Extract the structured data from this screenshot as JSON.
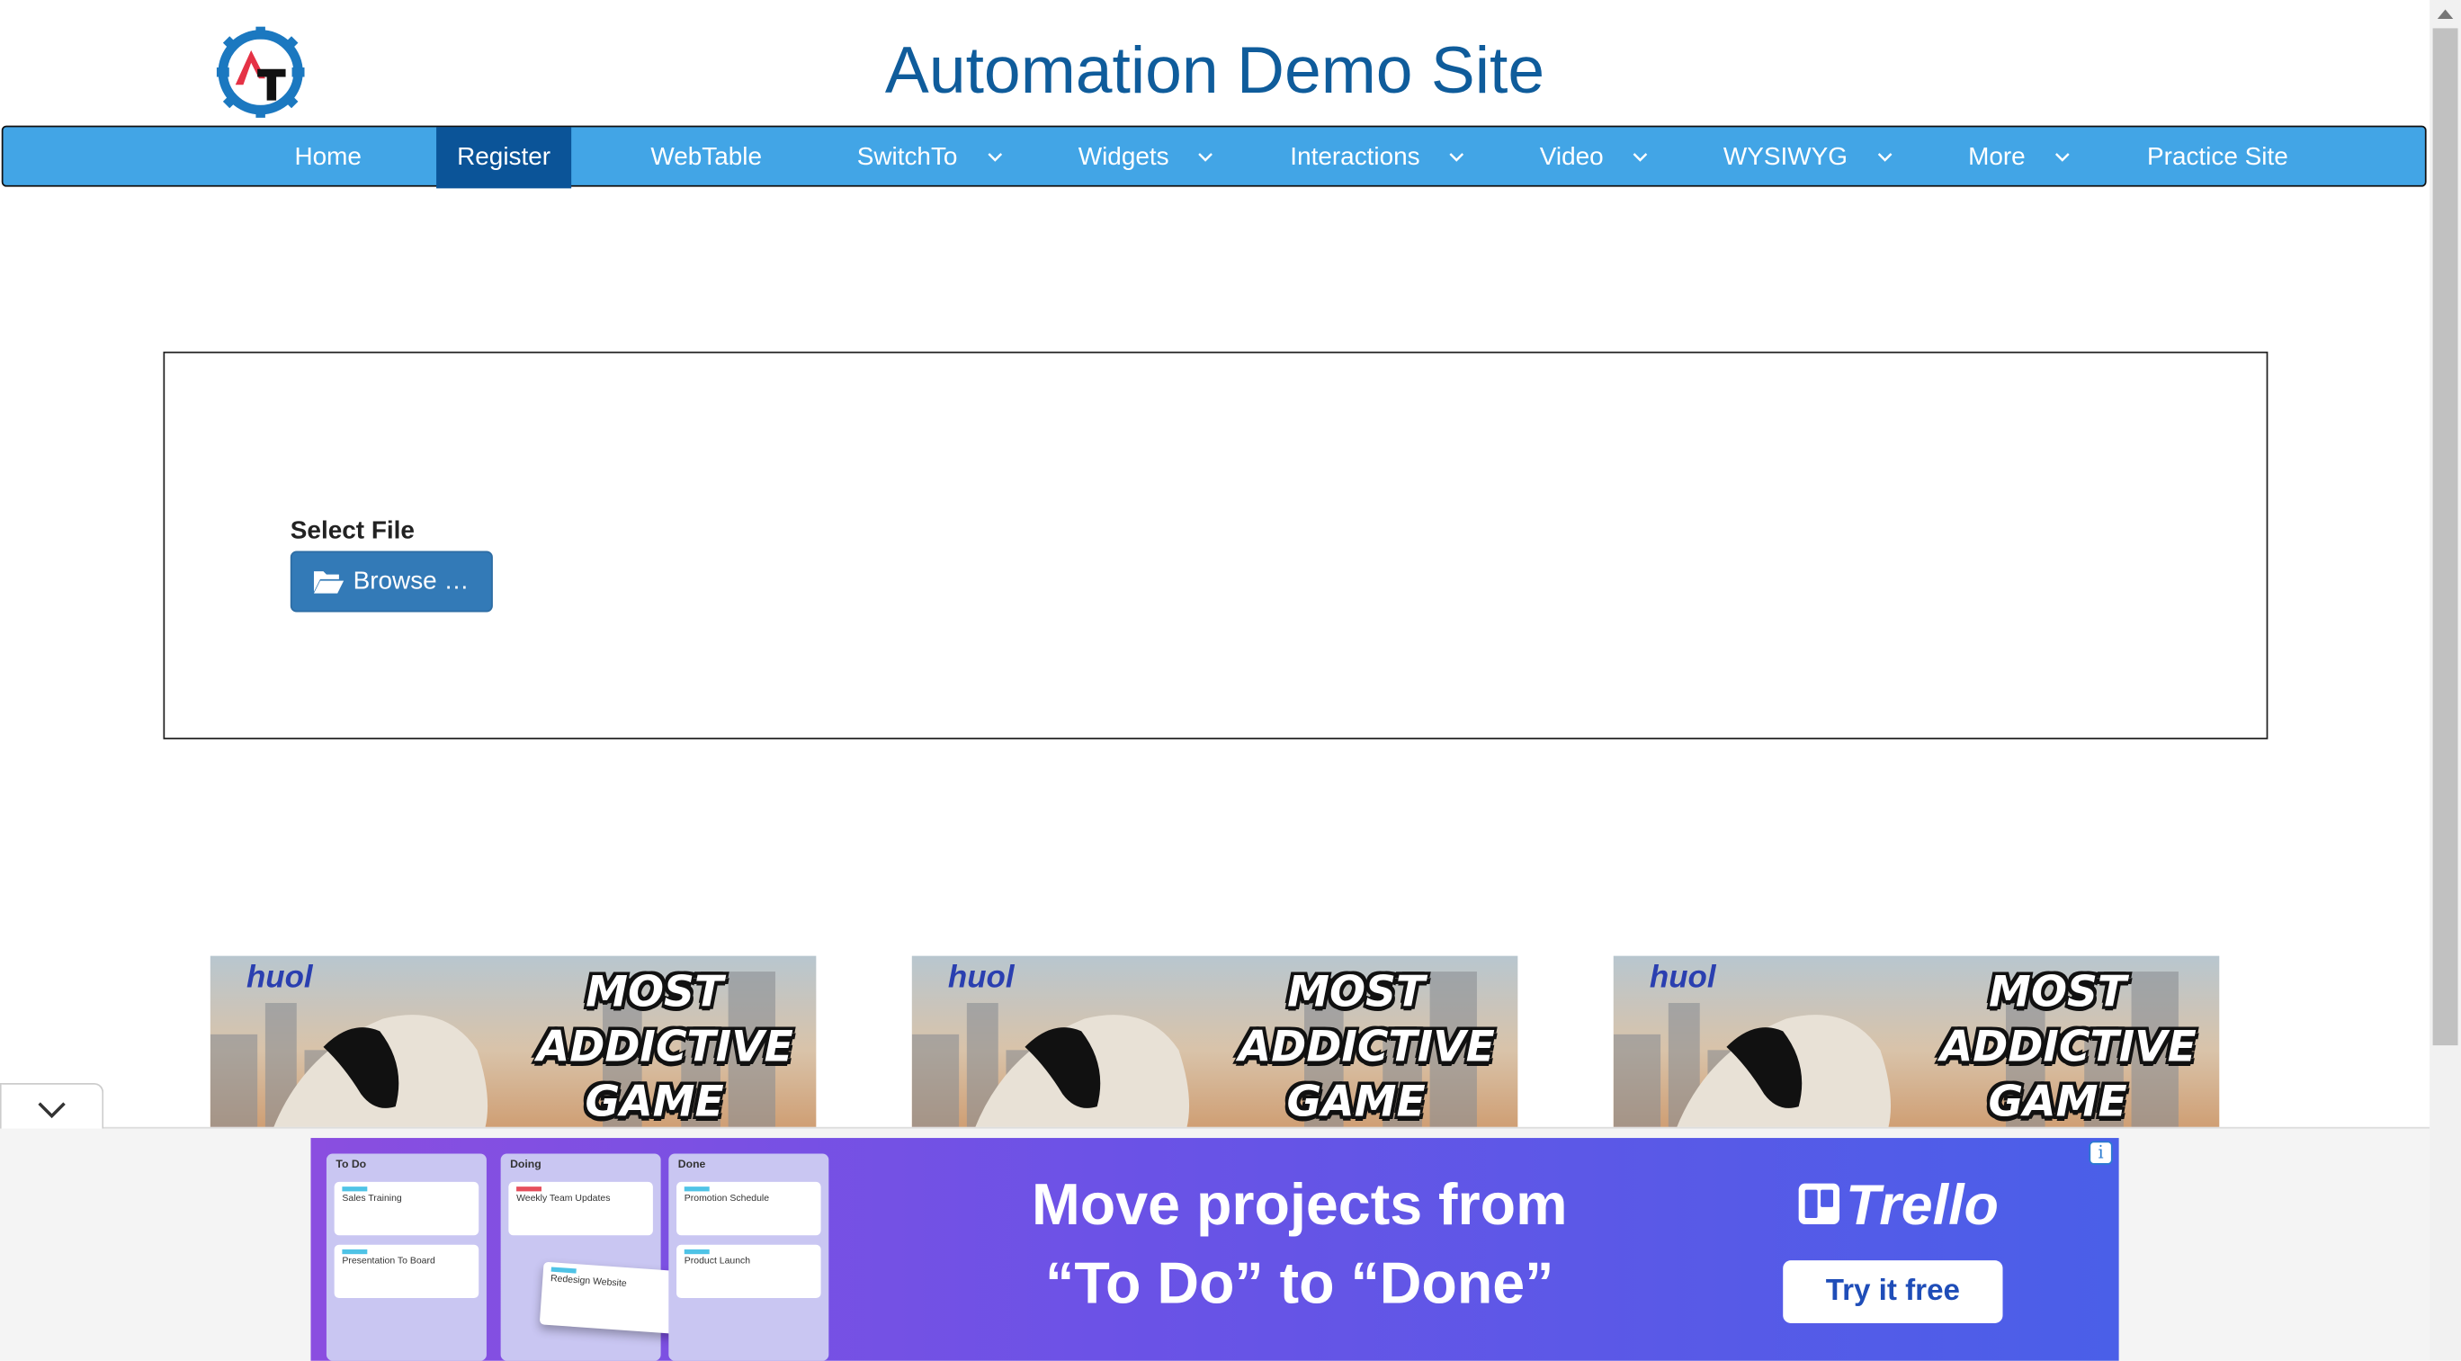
{
  "header": {
    "site_title": "Automation Demo Site",
    "logo_text": "AT"
  },
  "nav": {
    "active_index": 1,
    "items": [
      {
        "label": "Home",
        "has_dropdown": false
      },
      {
        "label": "Register",
        "has_dropdown": false
      },
      {
        "label": "WebTable",
        "has_dropdown": false
      },
      {
        "label": "SwitchTo",
        "has_dropdown": true
      },
      {
        "label": "Widgets",
        "has_dropdown": true
      },
      {
        "label": "Interactions",
        "has_dropdown": true
      },
      {
        "label": "Video",
        "has_dropdown": true
      },
      {
        "label": "WYSIWYG",
        "has_dropdown": true
      },
      {
        "label": "More",
        "has_dropdown": true
      },
      {
        "label": "Practice Site",
        "has_dropdown": false
      }
    ]
  },
  "upload": {
    "select_label": "Select File",
    "browse_label": "Browse …",
    "browse_icon": "folder-open-icon"
  },
  "game_ads": [
    {
      "brand": "huol",
      "headline_lines": [
        "MOST",
        "ADDICTIVE",
        "GAME"
      ]
    },
    {
      "brand": "huol",
      "headline_lines": [
        "MOST",
        "ADDICTIVE",
        "GAME"
      ]
    },
    {
      "brand": "huol",
      "headline_lines": [
        "MOST",
        "ADDICTIVE",
        "GAME"
      ]
    }
  ],
  "bottom_ad": {
    "headline_line1": "Move projects from",
    "headline_line2": "“To Do” to “Done”",
    "brand": "Trello",
    "cta": "Try it free",
    "info_icon": "info-icon",
    "board": {
      "columns": [
        {
          "title": "To Do",
          "cards": [
            "Sales Training",
            "Presentation To Board"
          ]
        },
        {
          "title": "Doing",
          "cards": [
            "Weekly Team Updates",
            "Redesign Website"
          ]
        },
        {
          "title": "Done",
          "cards": [
            "Promotion Schedule",
            "Product Launch"
          ]
        }
      ]
    }
  },
  "colors": {
    "title": "#0f5c9b",
    "nav_bg": "#42a5e6",
    "nav_active": "#0b5498",
    "button_primary": "#337ab7"
  }
}
